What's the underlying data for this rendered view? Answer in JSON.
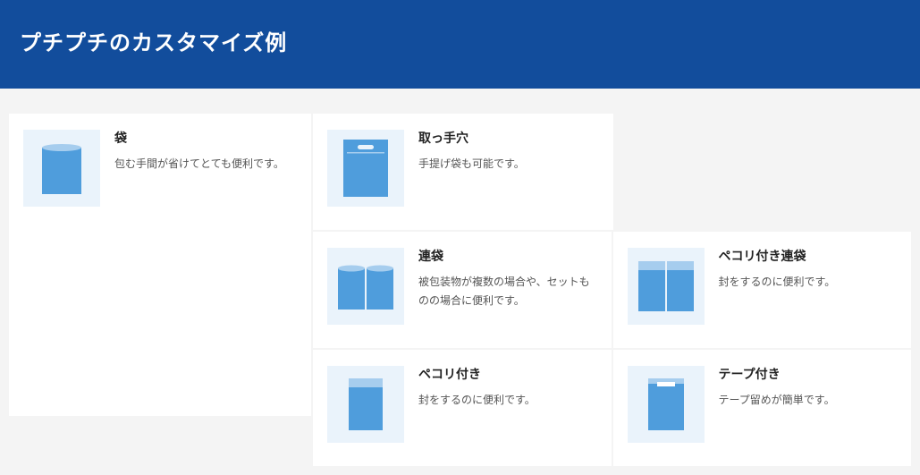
{
  "banner_title": "プチプチのカスタマイズ例",
  "cards": {
    "bag": {
      "title": "袋",
      "desc": "包む手間が省けてとても便利です。"
    },
    "handle": {
      "title": "取っ手穴",
      "desc": "手提げ袋も可能です。"
    },
    "multi": {
      "title": "連袋",
      "desc": "被包装物が複数の場合や、セットものの場合に便利です。"
    },
    "multi_flap": {
      "title": "ペコリ付き連袋",
      "desc": "封をするのに便利です。"
    },
    "flap": {
      "title": "ペコリ付き",
      "desc": "封をするのに便利です。"
    },
    "tape": {
      "title": "テープ付き",
      "desc": "テープ留めが簡単です。"
    }
  }
}
